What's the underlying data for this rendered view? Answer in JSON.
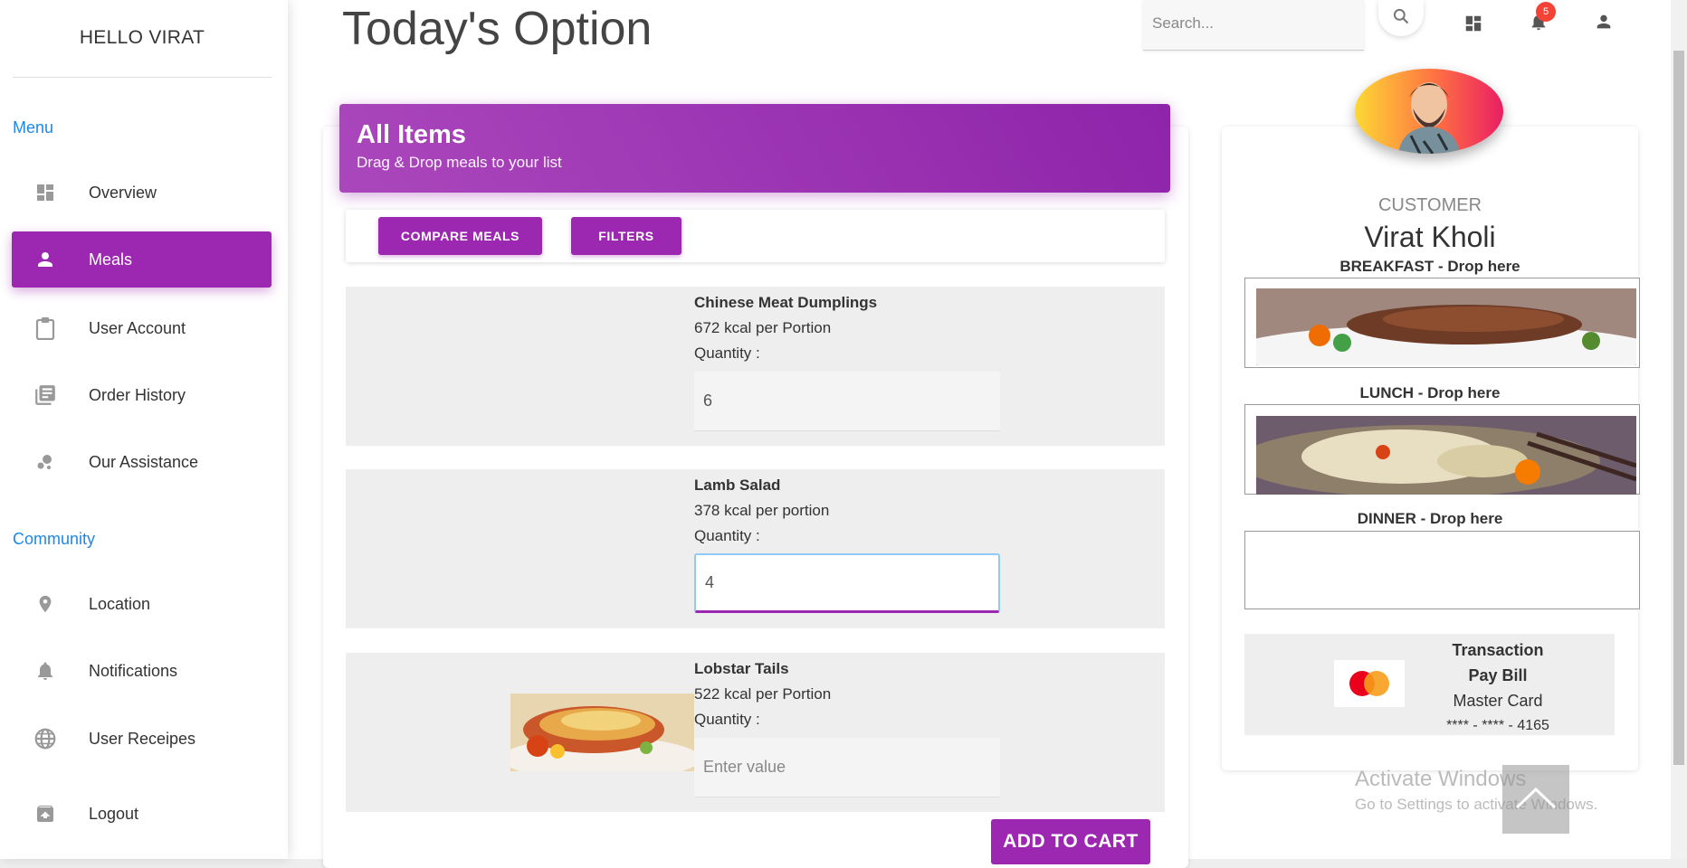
{
  "sidebar": {
    "greeting": "HELLO VIRAT",
    "menu_label": "Menu",
    "community_label": "Community",
    "menu_items": [
      {
        "label": "Overview",
        "icon": "dashboard-icon"
      },
      {
        "label": "Meals",
        "icon": "person-icon",
        "active": true
      },
      {
        "label": "User Account",
        "icon": "clipboard-icon"
      },
      {
        "label": "Order History",
        "icon": "library-books-icon"
      },
      {
        "label": "Our Assistance",
        "icon": "bubble-chart-icon"
      }
    ],
    "community_items": [
      {
        "label": "Location",
        "icon": "location-pin-icon"
      },
      {
        "label": "Notifications",
        "icon": "bell-icon"
      },
      {
        "label": "User Receipes",
        "icon": "globe-icon"
      },
      {
        "label": "Logout",
        "icon": "unarchive-icon"
      }
    ]
  },
  "header": {
    "title": "Today's Option",
    "search_placeholder": "Search...",
    "notification_count": "5"
  },
  "items_panel": {
    "title": "All Items",
    "subtitle": "Drag & Drop meals to your list",
    "compare_label": "COMPARE MEALS",
    "filters_label": "FILTERS",
    "add_to_cart_label": "ADD TO CART",
    "meals": [
      {
        "name": "Chinese Meat Dumplings",
        "kcal": "672 kcal per Portion",
        "quantity_label": "Quantity :",
        "quantity": "6"
      },
      {
        "name": "Lamb Salad",
        "kcal": "378 kcal per portion",
        "quantity_label": "Quantity :",
        "quantity": "4"
      },
      {
        "name": "Lobstar Tails",
        "kcal": "522 kcal per Portion",
        "quantity_label": "Quantity :",
        "quantity_placeholder": "Enter value"
      }
    ]
  },
  "profile": {
    "role": "CUSTOMER",
    "name": "Virat Kholi",
    "breakfast_label": "BREAKFAST - Drop here",
    "lunch_label": "LUNCH - Drop here",
    "dinner_label": "DINNER - Drop here",
    "transaction_label": "Transaction",
    "pay_bill_label": "Pay Bill",
    "card_type": "Master Card",
    "card_number": "**** - **** - 4165"
  },
  "watermark": {
    "line1": "Activate Windows",
    "line2": "Go to Settings to activate Windows."
  },
  "colors": {
    "accent": "#9c27b0",
    "link": "#1e88e5",
    "badge": "#f44336"
  }
}
